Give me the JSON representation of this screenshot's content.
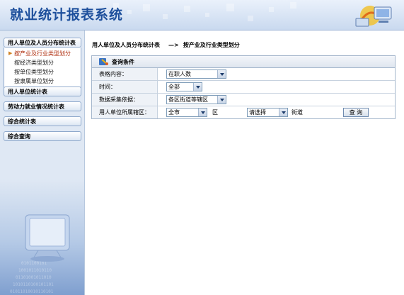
{
  "header": {
    "title": "就业统计报表系统"
  },
  "sidebar": {
    "groups": [
      {
        "label": "用人单位及人员分布统计表",
        "items": [
          {
            "label": "按产业及行业类型划分",
            "current": true
          },
          {
            "label": "按经济类型划分"
          },
          {
            "label": "按单位类型划分"
          },
          {
            "label": "按隶属单位划分"
          }
        ]
      },
      {
        "label": "用人单位统计表"
      },
      {
        "label": "劳动力就业情况统计表"
      },
      {
        "label": "综合统计表"
      },
      {
        "label": "综合查询"
      }
    ]
  },
  "breadcrumb": {
    "root": "用人单位及人员分布统计表",
    "sep": "—>",
    "current": "按产业及行业类型划分"
  },
  "query": {
    "title": "查询条件",
    "rows": {
      "content": {
        "label": "表格内容：",
        "value": "在职人数"
      },
      "time": {
        "label": "时间：",
        "value": "全部"
      },
      "basis": {
        "label": "数据采集依据：",
        "value": "各区街道等辖区"
      },
      "area": {
        "label": "用人单位所属辖区：",
        "city": "全市",
        "district_label": "区",
        "street": "请选择",
        "street_label": "街道",
        "button": "查 询"
      }
    }
  },
  "colors": {
    "title": "#1d4f9c",
    "current_item": "#b03010"
  }
}
